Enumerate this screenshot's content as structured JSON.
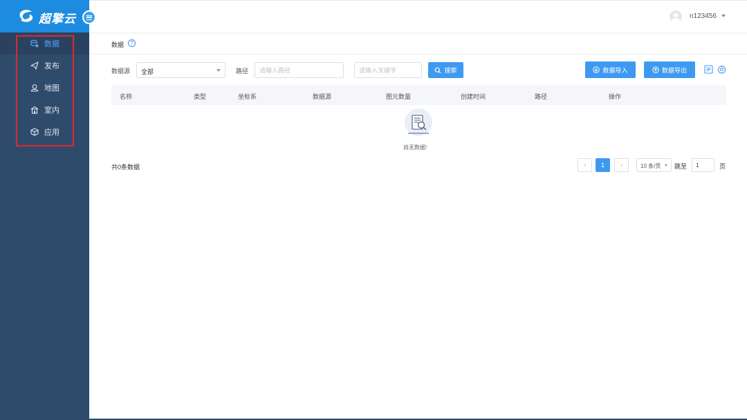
{
  "app": {
    "logo_text": "超擎云",
    "user": {
      "name": "n123456"
    }
  },
  "sidebar": {
    "items": [
      {
        "label": "数据",
        "icon": "database-icon",
        "active": true
      },
      {
        "label": "发布",
        "icon": "send-icon",
        "active": false
      },
      {
        "label": "地图",
        "icon": "map-pin-icon",
        "active": false
      },
      {
        "label": "室内",
        "icon": "building-icon",
        "active": false
      },
      {
        "label": "应用",
        "icon": "cube-icon",
        "active": false
      }
    ]
  },
  "page": {
    "title": "数据"
  },
  "filters": {
    "source_label": "数据源",
    "source_value": "全部",
    "path_label": "路径",
    "path_placeholder": "请输入路径",
    "keyword_placeholder": "请输入关键字",
    "search_button": "搜索"
  },
  "toolbar": {
    "import_button": "数据导入",
    "export_button": "数据导出"
  },
  "table": {
    "columns": [
      "名称",
      "类型",
      "坐标系",
      "数据源",
      "图元数量",
      "创建时间",
      "路径",
      "操作"
    ],
    "rows": [],
    "empty_text": "尚无数据!"
  },
  "pagination": {
    "total_text": "共0条数据",
    "prev": "‹",
    "current_page": "1",
    "next": "›",
    "page_size": "10 条/页",
    "jump_label": "跳至",
    "jump_value": "1",
    "page_unit": "页"
  },
  "colors": {
    "primary": "#3d9af0",
    "sidebar_bg": "#2f4b6c",
    "logo_bg": "#1d8ce0",
    "highlight": "#e02a2a"
  }
}
